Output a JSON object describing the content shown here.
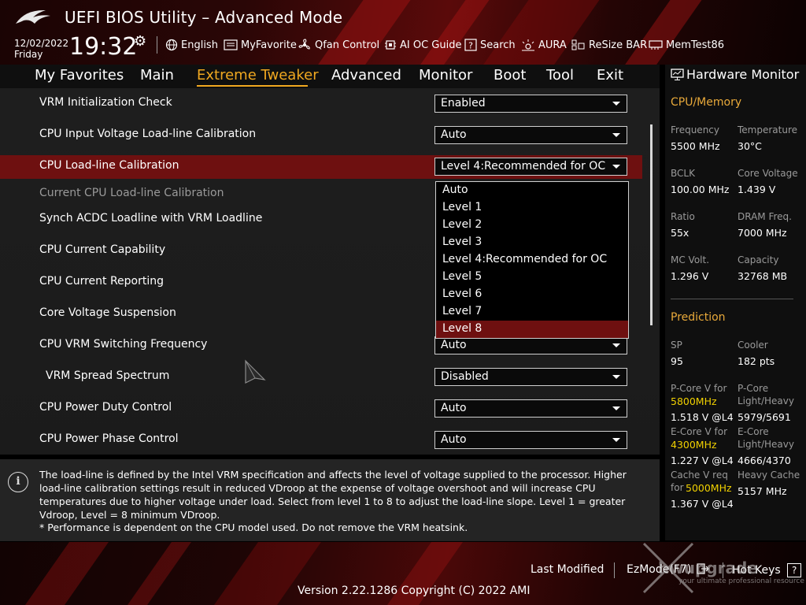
{
  "header": {
    "title": "UEFI BIOS Utility – Advanced Mode",
    "date": "12/02/2022",
    "day": "Friday",
    "time": "19:32",
    "tools": [
      {
        "label": "English",
        "icon": "globe-icon"
      },
      {
        "label": "MyFavorite",
        "icon": "favorite-icon"
      },
      {
        "label": "Qfan Control",
        "icon": "fan-icon"
      },
      {
        "label": "AI OC Guide",
        "icon": "ai-oc-guide-icon"
      },
      {
        "label": "Search",
        "icon": "search-icon"
      },
      {
        "label": "AURA",
        "icon": "aura-icon"
      },
      {
        "label": "ReSize BAR",
        "icon": "resize-bar-icon"
      },
      {
        "label": "MemTest86",
        "icon": "memtest-icon"
      }
    ]
  },
  "tabs": [
    "My Favorites",
    "Main",
    "Extreme Tweaker",
    "Advanced",
    "Monitor",
    "Boot",
    "Tool",
    "Exit"
  ],
  "active_tab": "Extreme Tweaker",
  "settings": [
    {
      "label": "VRM Initialization Check",
      "value": "Enabled"
    },
    {
      "label": "CPU Input Voltage Load-line Calibration",
      "value": "Auto"
    },
    {
      "label": "CPU Load-line Calibration",
      "value": "Level 4:Recommended for OC"
    },
    {
      "label": "Current CPU Load-line Calibration",
      "value": ""
    },
    {
      "label": "Synch ACDC Loadline with VRM Loadline",
      "value": ""
    },
    {
      "label": "CPU Current Capability",
      "value": ""
    },
    {
      "label": "CPU Current Reporting",
      "value": ""
    },
    {
      "label": "Core Voltage Suspension",
      "value": ""
    },
    {
      "label": "CPU VRM Switching Frequency",
      "value": "Auto"
    },
    {
      "label": "VRM Spread Spectrum",
      "value": "Disabled"
    },
    {
      "label": "CPU Power Duty Control",
      "value": "Auto"
    },
    {
      "label": "CPU Power Phase Control",
      "value": "Auto"
    }
  ],
  "dropdown": {
    "options": [
      "Auto",
      "Level 1",
      "Level 2",
      "Level 3",
      "Level 4:Recommended for OC",
      "Level 5",
      "Level 6",
      "Level 7",
      "Level 8"
    ],
    "highlighted": "Level 8"
  },
  "info": {
    "text": "The load-line is defined by the Intel VRM specification and affects the level of voltage supplied to the processor. Higher load-line calibration settings result in reduced VDroop at the expense of voltage overshoot and will increase CPU temperatures due to higher voltage under load. Select from level 1 to 8 to adjust the load-line slope. Level 1 = greater Vdroop, Level = 8 minimum VDroop.",
    "note": "* Performance is dependent on the CPU model used. Do not remove the VRM heatsink."
  },
  "hw_monitor": {
    "title": "Hardware Monitor",
    "cpu_memory": {
      "heading": "CPU/Memory",
      "items": [
        {
          "label": "Frequency",
          "value": "5500 MHz"
        },
        {
          "label": "Temperature",
          "value": "30°C"
        },
        {
          "label": "BCLK",
          "value": "100.00 MHz"
        },
        {
          "label": "Core Voltage",
          "value": "1.439 V"
        },
        {
          "label": "Ratio",
          "value": "55x"
        },
        {
          "label": "DRAM Freq.",
          "value": "7000 MHz"
        },
        {
          "label": "MC Volt.",
          "value": "1.296 V"
        },
        {
          "label": "Capacity",
          "value": "32768 MB"
        }
      ]
    },
    "prediction": {
      "heading": "Prediction",
      "sp_label": "SP",
      "sp_value": "95",
      "cooler_label": "Cooler",
      "cooler_value": "182 pts",
      "pcore_v_label": "P-Core V for",
      "pcore_v_freq": "5800MHz",
      "pcore_v_value": "1.518 V @L4",
      "pcore_label": "P-Core",
      "pcore_sub": "Light/Heavy",
      "pcore_value": "5979/5691",
      "ecore_v_label": "E-Core V for",
      "ecore_v_freq": "4300MHz",
      "ecore_v_value": "1.227 V @L4",
      "ecore_label": "E-Core",
      "ecore_sub": "Light/Heavy",
      "ecore_value": "4666/4370",
      "cache_v_label": "Cache V req",
      "cache_v_for": "for",
      "cache_v_freq": "5000MHz",
      "cache_v_value": "1.367 V @L4",
      "heavy_cache_label": "Heavy Cache",
      "heavy_cache_value": "5157 MHz"
    }
  },
  "footer": {
    "last_modified": "Last Modified",
    "ez_mode": "EzMode(F7)",
    "hot_keys": "Hot Keys",
    "hot_keys_glyph": "?",
    "version": "Version 2.22.1286 Copyright (C) 2022 AMI",
    "watermark_main": "hwupgrade",
    "watermark_sub": "your ultimate professional resource"
  },
  "colors": {
    "accent": "#f0a820",
    "highlight": "#6e1010",
    "prediction_yellow": "#f0d000",
    "section_orange": "#e8a93a"
  }
}
